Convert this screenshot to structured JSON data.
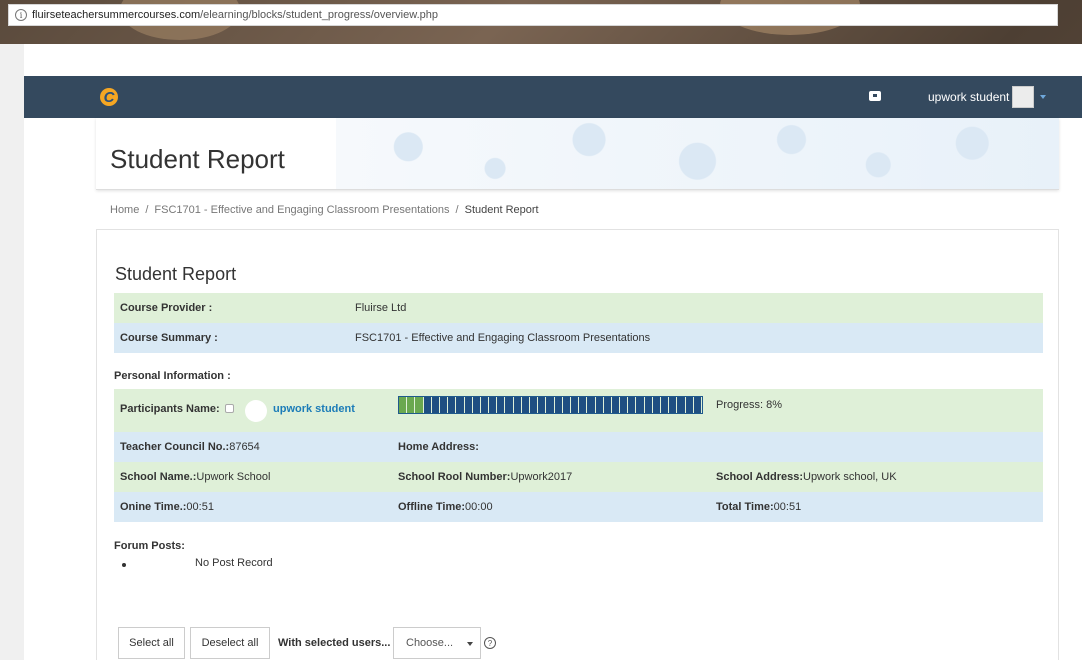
{
  "browser": {
    "url_host": "fluirseteachersummercourses.com",
    "url_path": "/elearning/blocks/student_progress/overview.php"
  },
  "navbar": {
    "user_name": "upwork student",
    "accent": "#34495e"
  },
  "header": {
    "page_title": "Student Report"
  },
  "breadcrumb": {
    "items": [
      "Home",
      "FSC1701 - Effective and Engaging Classroom Presentations",
      "Student Report"
    ],
    "separator": "/"
  },
  "report": {
    "title": "Student Report",
    "course_provider_label": "Course Provider :",
    "course_provider_value": "Fluirse Ltd",
    "course_summary_label": "Course Summary :",
    "course_summary_value": "FSC1701 - Effective and Engaging Classroom Presentations",
    "personal_info_label": "Personal Information :",
    "participants_name_label": "Participants Name:",
    "participant_name": "upwork student",
    "progress_text": "Progress: 8%",
    "progress_fraction": 0.08,
    "teacher_council_label": "Teacher Council No.:",
    "teacher_council_value": "87654",
    "home_address_label": "Home Address:",
    "home_address_value": "",
    "school_name_label": "School Name.:",
    "school_name_value": "Upwork School",
    "school_roll_label": "School Rool Number:",
    "school_roll_value": "Upwork2017",
    "school_address_label": "School Address:",
    "school_address_value": "Upwork school, UK",
    "online_time_label": "Onine Time.:",
    "online_time_value": "00:51",
    "offline_time_label": "Offline Time:",
    "offline_time_value": "00:00",
    "total_time_label": "Total Time:",
    "total_time_value": "00:51",
    "forum_posts_label": "Forum Posts:",
    "forum_posts_items": [
      "No Post Record"
    ],
    "colors": {
      "green_row": "#dff0d8",
      "blue_row": "#d9e9f5",
      "progress_done": "#6aa84f",
      "progress_remaining": "#1f4f82",
      "link": "#1c7cb8"
    }
  },
  "actions": {
    "select_all_label": "Select all",
    "deselect_all_label": "Deselect all",
    "with_selected_label": "With selected users...",
    "choose_selected": "Choose...",
    "help_icon": "question-circle-icon"
  }
}
